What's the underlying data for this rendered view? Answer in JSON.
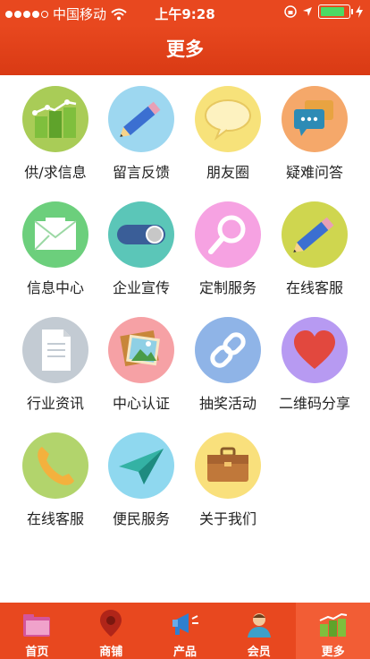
{
  "status": {
    "carrier": "中国移动",
    "time": "上午9:28"
  },
  "header": {
    "title": "更多"
  },
  "items": [
    {
      "label": "供/求信息",
      "icon": "bar-chart-icon",
      "bg": "#a9cc57"
    },
    {
      "label": "留言反馈",
      "icon": "pencil-icon",
      "bg": "#9dd7f0"
    },
    {
      "label": "朋友圈",
      "icon": "speech-bubble-icon",
      "bg": "#f7e27a"
    },
    {
      "label": "疑难问答",
      "icon": "chat-bubbles-icon",
      "bg": "#f5a86a"
    },
    {
      "label": "信息中心",
      "icon": "envelope-icon",
      "bg": "#6ccf7c"
    },
    {
      "label": "企业宣传",
      "icon": "toggle-icon",
      "bg": "#5bc6b8"
    },
    {
      "label": "定制服务",
      "icon": "magnifier-icon",
      "bg": "#f6a2e2"
    },
    {
      "label": "在线客服",
      "icon": "pencil-icon",
      "bg": "#cfd64f"
    },
    {
      "label": "行业资讯",
      "icon": "document-icon",
      "bg": "#c3cbd3"
    },
    {
      "label": "中心认证",
      "icon": "picture-icon",
      "bg": "#f6a1a5"
    },
    {
      "label": "抽奖活动",
      "icon": "link-icon",
      "bg": "#8fb4e7"
    },
    {
      "label": "二维码分享",
      "icon": "heart-icon",
      "bg": "#b79af2"
    },
    {
      "label": "在线客服",
      "icon": "phone-icon",
      "bg": "#b2d46c"
    },
    {
      "label": "便民服务",
      "icon": "paper-plane-icon",
      "bg": "#8fd8ef"
    },
    {
      "label": "关于我们",
      "icon": "briefcase-icon",
      "bg": "#f9e07c"
    }
  ],
  "tabs": [
    {
      "label": "首页",
      "icon": "folder-icon",
      "active": false
    },
    {
      "label": "商铺",
      "icon": "map-pin-icon",
      "active": false
    },
    {
      "label": "产品",
      "icon": "megaphone-icon",
      "active": false
    },
    {
      "label": "会员",
      "icon": "user-icon",
      "active": false
    },
    {
      "label": "更多",
      "icon": "bar-chart-icon",
      "active": true
    }
  ]
}
